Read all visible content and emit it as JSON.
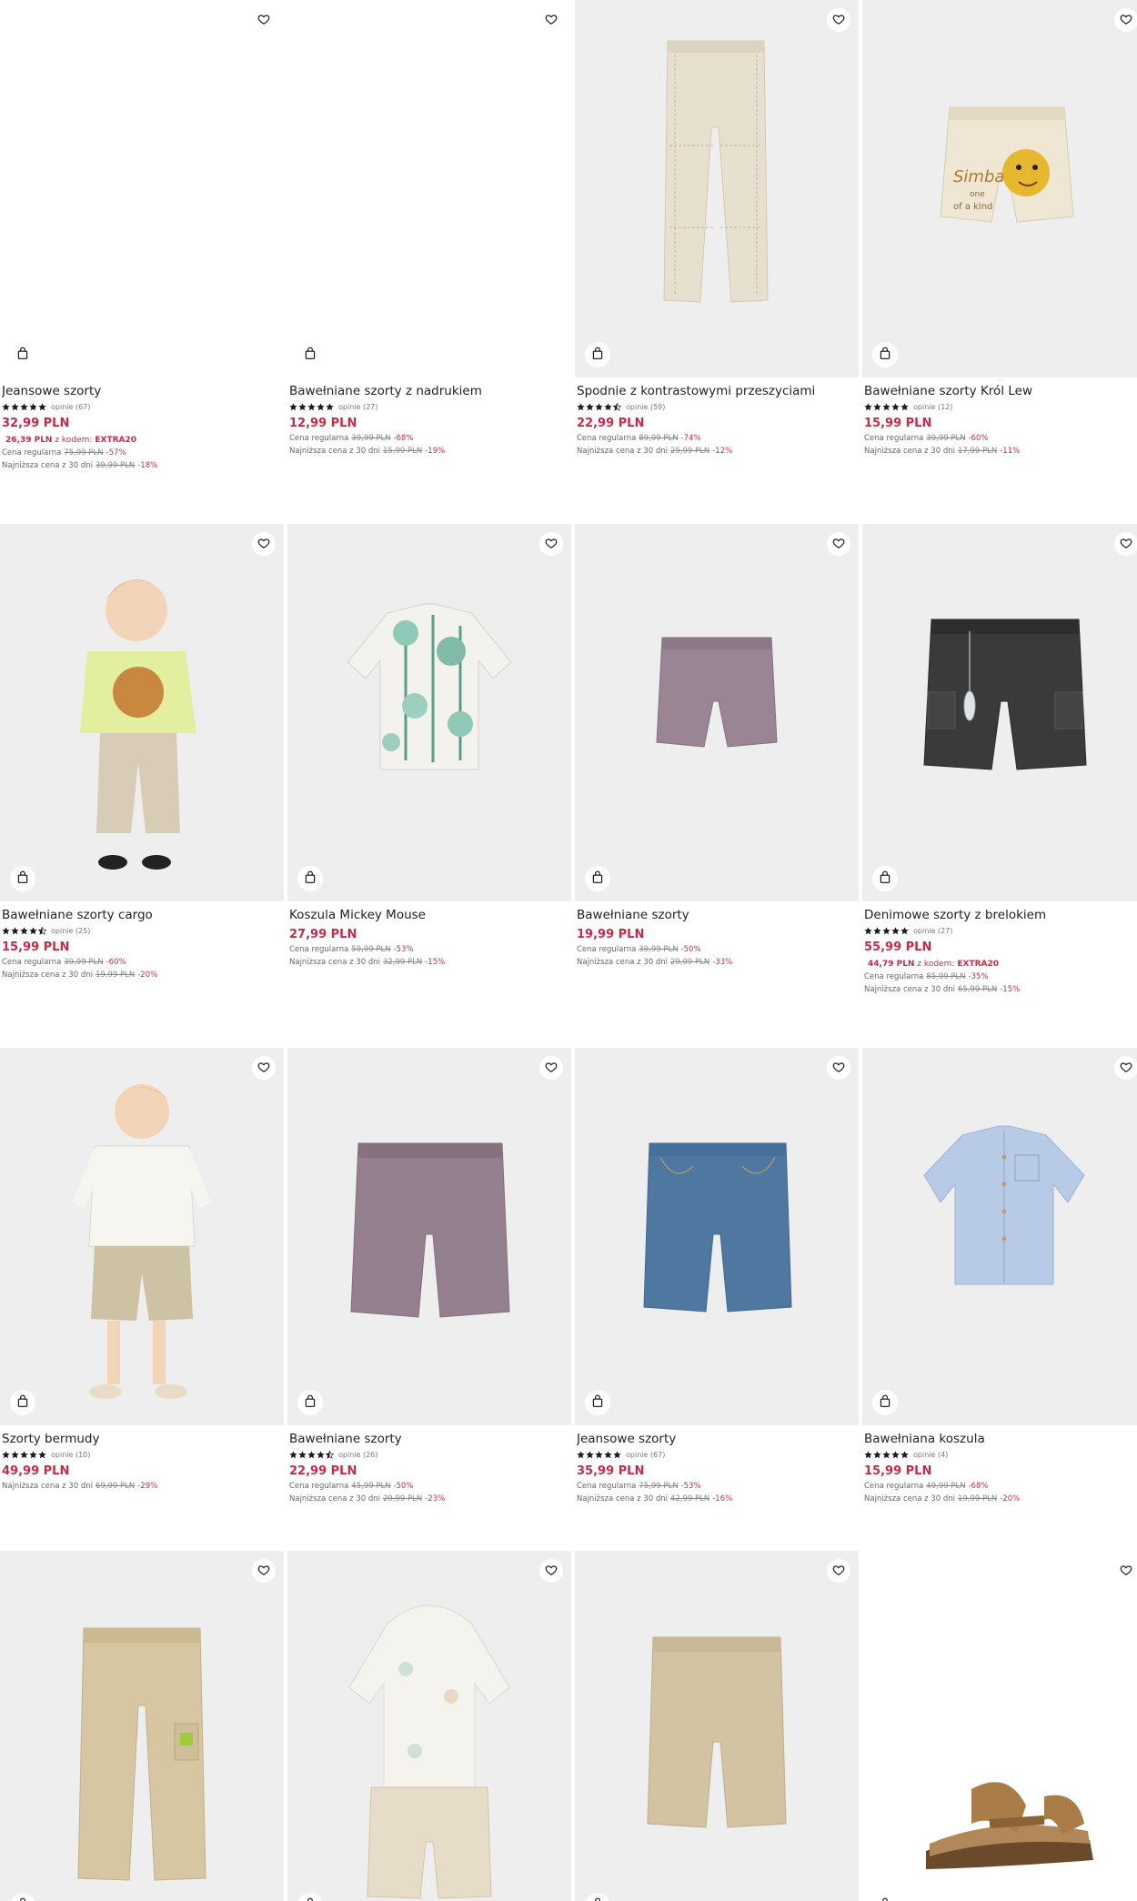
{
  "colors": {
    "accent": "#c62c46",
    "image_bg": "#eeeeee",
    "text": "#222222"
  },
  "products": [
    {
      "name": "Jeansowe szorty",
      "has_rating": true,
      "stars": 5,
      "reviews": "opinie (67)",
      "price": "32,99 PLN",
      "promo": {
        "price": "26,39 PLN",
        "text": "z kodem:",
        "code": "EXTRA20"
      },
      "regular": {
        "label": "Cena regularna",
        "old": "75,99 PLN",
        "disc": "-57%"
      },
      "lowest": {
        "label": "Najniższa cena z 30 dni",
        "old": "39,99 PLN",
        "disc": "-18%"
      },
      "image": "none",
      "blank": true
    },
    {
      "name": "Bawełniane szorty z nadrukiem",
      "has_rating": true,
      "stars": 5,
      "reviews": "opinie (27)",
      "price": "12,99 PLN",
      "regular": {
        "label": "Cena regularna",
        "old": "39,99 PLN",
        "disc": "-68%"
      },
      "lowest": {
        "label": "Najniższa cena z 30 dni",
        "old": "15,99 PLN",
        "disc": "-19%"
      },
      "image": "none",
      "blank": true
    },
    {
      "name": "Spodnie z kontrastowymi przeszyciami",
      "has_rating": true,
      "stars": 4.5,
      "reviews": "opinie (59)",
      "price": "22,99 PLN",
      "regular": {
        "label": "Cena regularna",
        "old": "89,99 PLN",
        "disc": "-74%"
      },
      "lowest": {
        "label": "Najniższa cena z 30 dni",
        "old": "25,99 PLN",
        "disc": "-12%"
      },
      "image": "pants-cream"
    },
    {
      "name": "Bawełniane szorty Król Lew",
      "has_rating": true,
      "stars": 5,
      "reviews": "opinie (12)",
      "price": "15,99 PLN",
      "regular": {
        "label": "Cena regularna",
        "old": "39,99 PLN",
        "disc": "-60%"
      },
      "lowest": {
        "label": "Najniższa cena z 30 dni",
        "old": "17,99 PLN",
        "disc": "-11%"
      },
      "image": "shorts-simba",
      "print_lines": [
        "Simba",
        "one",
        "of a kind"
      ]
    },
    {
      "name": "Bawełniane szorty cargo",
      "has_rating": true,
      "stars": 4.5,
      "reviews": "opinie (25)",
      "price": "15,99 PLN",
      "regular": {
        "label": "Cena regularna",
        "old": "39,99 PLN",
        "disc": "-60%"
      },
      "lowest": {
        "label": "Najniższa cena z 30 dni",
        "old": "19,99 PLN",
        "disc": "-20%"
      },
      "image": "model-lion-tee"
    },
    {
      "name": "Koszula Mickey Mouse",
      "has_rating": false,
      "price": "27,99 PLN",
      "regular": {
        "label": "Cena regularna",
        "old": "59,99 PLN",
        "disc": "-53%"
      },
      "lowest": {
        "label": "Najniższa cena z 30 dni",
        "old": "32,99 PLN",
        "disc": "-15%"
      },
      "image": "shirt-palm"
    },
    {
      "name": "Bawełniane szorty",
      "has_rating": false,
      "price": "19,99 PLN",
      "regular": {
        "label": "Cena regularna",
        "old": "39,99 PLN",
        "disc": "-50%"
      },
      "lowest": {
        "label": "Najniższa cena z 30 dni",
        "old": "29,99 PLN",
        "disc": "-33%"
      },
      "image": "shorts-mauve-small"
    },
    {
      "name": "Denimowe szorty z brelokiem",
      "has_rating": true,
      "stars": 5,
      "reviews": "opinie (27)",
      "price": "55,99 PLN",
      "promo": {
        "price": "44,79 PLN",
        "text": "z kodem:",
        "code": "EXTRA20"
      },
      "regular": {
        "label": "Cena regularna",
        "old": "85,99 PLN",
        "disc": "-35%"
      },
      "lowest": {
        "label": "Najniższa cena z 30 dni",
        "old": "65,99 PLN",
        "disc": "-15%"
      },
      "image": "shorts-black-denim"
    },
    {
      "name": "Szorty bermudy",
      "has_rating": true,
      "stars": 5,
      "reviews": "opinie (10)",
      "price": "49,99 PLN",
      "lowest": {
        "label": "Najniższa cena z 30 dni",
        "old": "69,99 PLN",
        "disc": "-29%"
      },
      "image": "model-white-shirt"
    },
    {
      "name": "Bawełniane szorty",
      "has_rating": true,
      "stars": 4.5,
      "reviews": "opinie (26)",
      "price": "22,99 PLN",
      "regular": {
        "label": "Cena regularna",
        "old": "45,99 PLN",
        "disc": "-50%"
      },
      "lowest": {
        "label": "Najniższa cena z 30 dni",
        "old": "29,99 PLN",
        "disc": "-23%"
      },
      "image": "shorts-mauve-large"
    },
    {
      "name": "Jeansowe szorty",
      "has_rating": true,
      "stars": 5,
      "reviews": "opinie (67)",
      "price": "35,99 PLN",
      "regular": {
        "label": "Cena regularna",
        "old": "75,99 PLN",
        "disc": "-53%"
      },
      "lowest": {
        "label": "Najniższa cena z 30 dni",
        "old": "42,99 PLN",
        "disc": "-16%"
      },
      "image": "shorts-blue-denim"
    },
    {
      "name": "Bawełniana koszula",
      "has_rating": true,
      "stars": 5,
      "reviews": "opinie (4)",
      "price": "15,99 PLN",
      "regular": {
        "label": "Cena regularna",
        "old": "49,99 PLN",
        "disc": "-68%"
      },
      "lowest": {
        "label": "Najniższa cena z 30 dni",
        "old": "19,99 PLN",
        "disc": "-20%"
      },
      "image": "shirt-blue"
    },
    {
      "image": "pants-cargo-beige",
      "partial": true
    },
    {
      "image": "set-hoodie-shirt",
      "partial": true
    },
    {
      "image": "shorts-beige",
      "partial": true
    },
    {
      "image": "sandals",
      "partial": true,
      "white_bg": true
    }
  ]
}
